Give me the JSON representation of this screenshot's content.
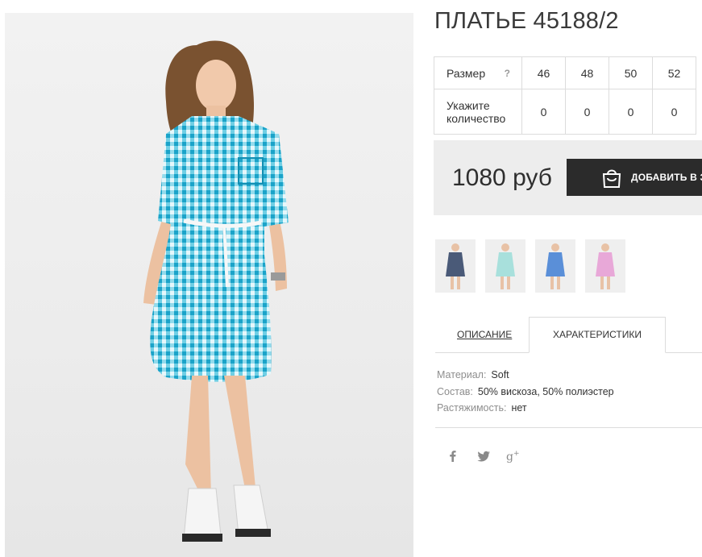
{
  "product": {
    "title": "ПЛАТЬЕ 45188/2",
    "image_alt": "woman-in-blue-gingham-shirt-dress"
  },
  "size_table": {
    "size_label": "Размер",
    "help_mark": "?",
    "qty_label": "Укажите количество",
    "sizes": [
      "46",
      "48",
      "50",
      "52"
    ],
    "quantities": [
      "0",
      "0",
      "0",
      "0"
    ]
  },
  "buy": {
    "price": "1080 руб",
    "add_label": "ДОБАВИТЬ В З"
  },
  "thumbnails": [
    {
      "name": "thumb-navy-dress",
      "color": "#4a5a78"
    },
    {
      "name": "thumb-mint-dress",
      "color": "#a8e0dc"
    },
    {
      "name": "thumb-blue-dress",
      "color": "#5a8fd8"
    },
    {
      "name": "thumb-pink-dress",
      "color": "#e8a8d8"
    }
  ],
  "tabs": {
    "description": "ОПИСАНИЕ",
    "characteristics": "ХАРАКТЕРИСТИКИ"
  },
  "specs": [
    {
      "key": "Материал:",
      "value": "Soft"
    },
    {
      "key": "Состав:",
      "value": "50% вискоза, 50% полиэстер"
    },
    {
      "key": "Растяжимость:",
      "value": "нет"
    }
  ],
  "social": [
    "facebook-icon",
    "twitter-icon",
    "google-plus-icon"
  ],
  "colors": {
    "button_bg": "#2b2b2b",
    "buybox_bg": "#ededed",
    "dress_primary": "#2ab3d6",
    "border": "#dcdcdc"
  }
}
